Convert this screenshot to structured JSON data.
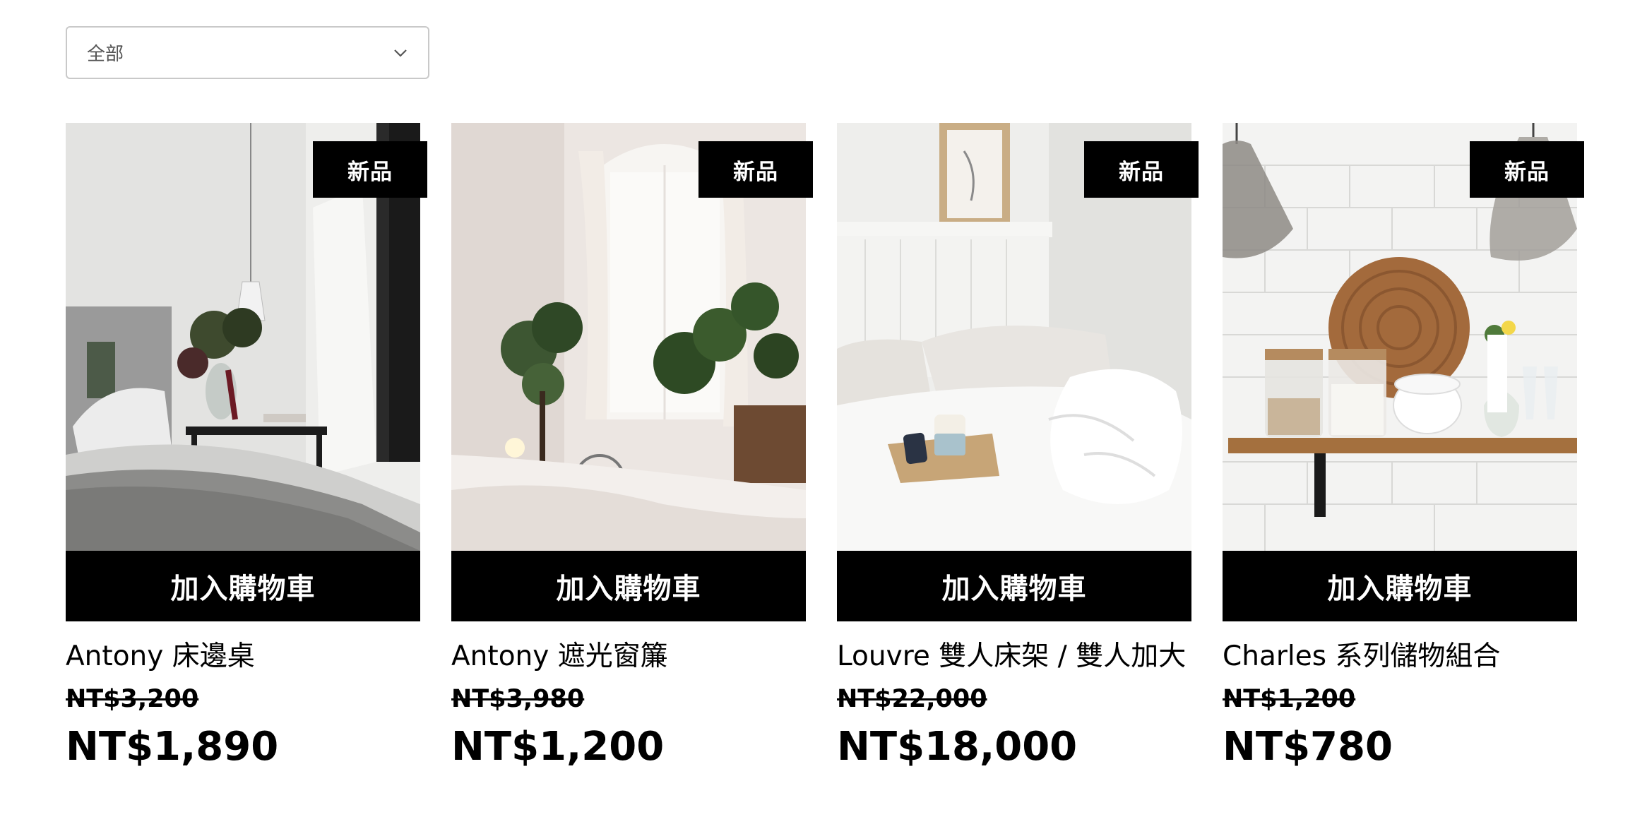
{
  "filter": {
    "selected": "全部",
    "icon": "chevron-down-icon"
  },
  "products": [
    {
      "badge": "新品",
      "add_to_cart": "加入購物車",
      "name": "Antony 床邊桌",
      "original_price": "NT$3,200",
      "price": "NT$1,890"
    },
    {
      "badge": "新品",
      "add_to_cart": "加入購物車",
      "name": "Antony 遮光窗簾",
      "original_price": "NT$3,980",
      "price": "NT$1,200"
    },
    {
      "badge": "新品",
      "add_to_cart": "加入購物車",
      "name": "Louvre 雙人床架 / 雙人加大",
      "original_price": "NT$22,000",
      "price": "NT$18,000"
    },
    {
      "badge": "新品",
      "add_to_cart": "加入購物車",
      "name": "Charles 系列儲物組合",
      "original_price": "NT$1,200",
      "price": "NT$780"
    }
  ]
}
